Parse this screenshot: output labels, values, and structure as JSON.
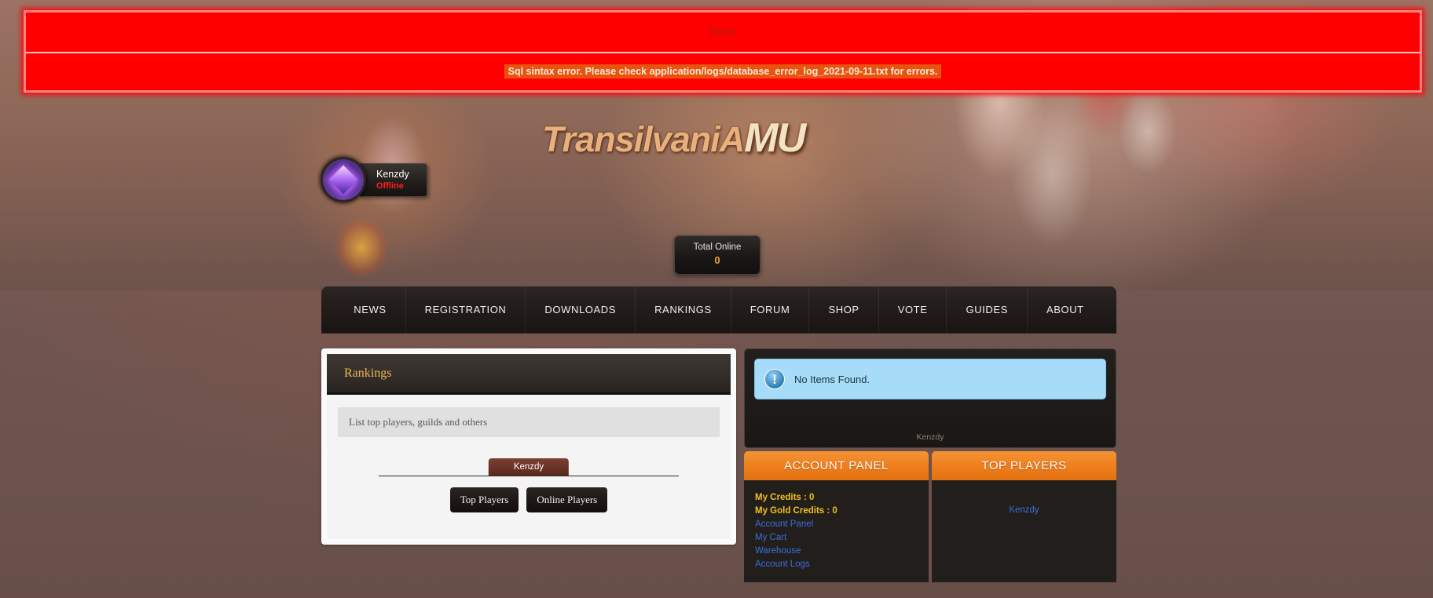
{
  "error": {
    "title": "Error",
    "message": "Sql sintax error. Please check application/logs/database_error_log_2021-09-11.txt for errors."
  },
  "branding": {
    "logo_text": "TransilvaniA",
    "logo_suffix": "MU"
  },
  "player": {
    "name": "Kenzdy",
    "status": "Offline",
    "avatar_icon": "crystal-avatar-icon"
  },
  "total_online": {
    "label": "Total Online",
    "value": "0"
  },
  "nav": {
    "items": [
      {
        "label": "NEWS"
      },
      {
        "label": "REGISTRATION"
      },
      {
        "label": "DOWNLOADS"
      },
      {
        "label": "RANKINGS"
      },
      {
        "label": "FORUM"
      },
      {
        "label": "SHOP"
      },
      {
        "label": "VOTE"
      },
      {
        "label": "GUIDES"
      },
      {
        "label": "ABOUT"
      }
    ]
  },
  "rankings_panel": {
    "title": "Rankings",
    "subtitle": "List top players, guilds and others",
    "active_tab": "Kenzdy",
    "buttons": [
      {
        "label": "Top Players"
      },
      {
        "label": "Online Players"
      }
    ]
  },
  "alert": {
    "icon": "info-exclamation-icon",
    "text": "No Items Found.",
    "footnote": "Kenzdy"
  },
  "account_panel": {
    "title": "ACCOUNT PANEL",
    "credits_label": "My Credits : 0",
    "gold_credits_label": "My Gold Credits : 0",
    "links": [
      {
        "label": "Account Panel"
      },
      {
        "label": "My Cart"
      },
      {
        "label": "Warehouse"
      },
      {
        "label": "Account Logs"
      }
    ]
  },
  "top_players": {
    "title": "TOP PLAYERS",
    "players": [
      {
        "name": "Kenzdy"
      }
    ]
  },
  "colors": {
    "error_red": "#ff0000",
    "error_msg_bg": "#e8530f",
    "accent_orange": "#ef7f1f",
    "gold_text": "#f0c11a",
    "link_blue": "#3a6fd8",
    "panel_title_gold": "#f0b851",
    "offline_red": "#ff1c1c"
  }
}
